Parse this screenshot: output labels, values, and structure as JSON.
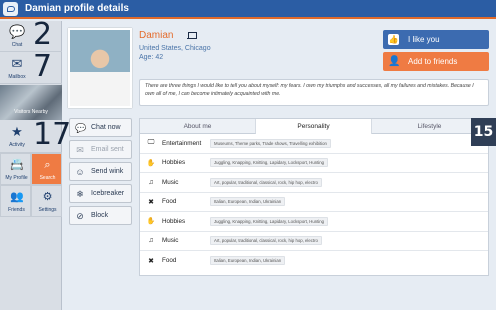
{
  "topbar": {
    "title": "Damian profile details",
    "app_icon": "chat-bubble-icon"
  },
  "sidebar": {
    "chat": {
      "label": "Chat",
      "count": "2",
      "icon": "chat-bubbles-icon"
    },
    "mailbox": {
      "label": "Mailbox",
      "count": "7",
      "icon": "envelope-icon"
    },
    "visitors": {
      "label": "Visitors Nearby"
    },
    "activity": {
      "label": "Activity",
      "count": "17",
      "icon": "star-icon"
    },
    "my_profile": {
      "label": "My Profile",
      "icon": "id-card-icon"
    },
    "search": {
      "label": "Search",
      "icon": "magnifier-icon"
    },
    "friends": {
      "label": "Friends",
      "icon": "people-icon"
    },
    "settings": {
      "label": "Settings",
      "icon": "gears-icon"
    }
  },
  "profile": {
    "name": "Damian",
    "location": "United States, Chicago",
    "age": "Age: 42",
    "bio": "There are three things I would like to tell you about myself: my fears. I own my triumphs and successes, all my failures and mistakes. Because I own all of me, I can become intimately acquainted with me."
  },
  "buttons": {
    "like": "I like you",
    "add_friend": "Add to friends"
  },
  "actions": [
    {
      "label": "Chat now",
      "icon": "chat-icon"
    },
    {
      "label": "Email sent",
      "icon": "email-icon"
    },
    {
      "label": "Send wink",
      "icon": "smiley-icon"
    },
    {
      "label": "Icebreaker",
      "icon": "icebreaker-icon"
    },
    {
      "label": "Block",
      "icon": "block-icon"
    }
  ],
  "tabs": [
    "About me",
    "Personality",
    "Lifestyle"
  ],
  "active_tab": "Personality",
  "rows": [
    {
      "icon": "tv-icon",
      "category": "Entertainment",
      "values": "Museums, Theme parks, Trade shows, Travelling exhibition"
    },
    {
      "icon": "hand-icon",
      "category": "Hobbies",
      "values": "Juggling, Knapping, Knitting, Lapidary, Locksport, Hunting"
    },
    {
      "icon": "music-note-icon",
      "category": "Music",
      "values": "Art, popular, traditional, classical, rock, hip hop, electro"
    },
    {
      "icon": "utensils-icon",
      "category": "Food",
      "values": "Italian, European, Indian, Ukrainian"
    },
    {
      "icon": "hand-icon",
      "category": "Hobbies",
      "values": "Juggling, Knapping, Knitting, Lapidary, Locksport, Hunting"
    },
    {
      "icon": "music-note-icon",
      "category": "Music",
      "values": "Art, popular, traditional, classical, rock, hip hop, electro"
    },
    {
      "icon": "utensils-icon",
      "category": "Food",
      "values": "Italian, European, Indian, Ukrainian"
    }
  ],
  "badge": "15",
  "colors": {
    "primary": "#2b5da4",
    "accent": "#ef7b43",
    "name": "#e46b2c"
  }
}
